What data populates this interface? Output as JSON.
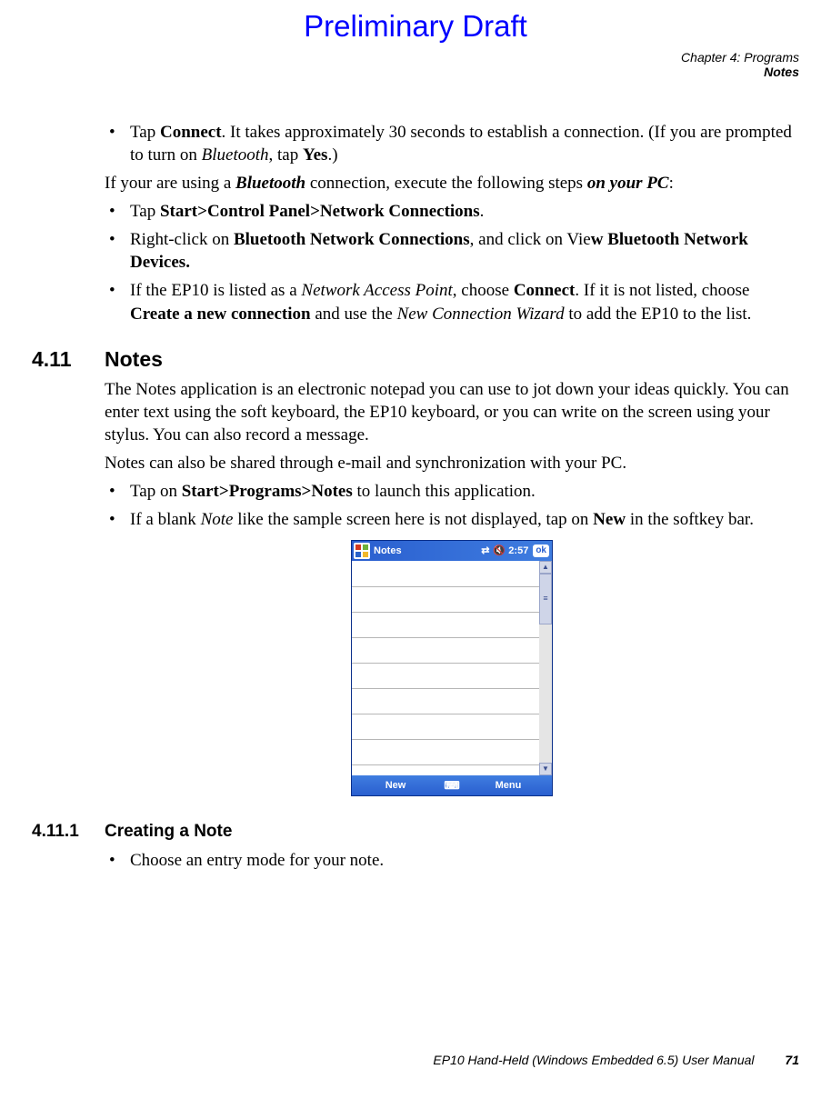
{
  "header": {
    "draft": "Preliminary Draft",
    "chapter": "Chapter 4: Programs",
    "section_label": "Notes"
  },
  "body": {
    "li1_a": "Tap ",
    "li1_b": "Connect",
    "li1_c": ". It takes approximately 30 seconds to establish a connection. (If you are prompted to turn on ",
    "li1_d": "Bluetooth",
    "li1_e": ", tap ",
    "li1_f": "Yes",
    "li1_g": ".)",
    "p1_a": "If your are using a ",
    "p1_b": "Bluetooth",
    "p1_c": " connection, execute the following steps ",
    "p1_d": "on your PC",
    "p1_e": ":",
    "li2_a": "Tap ",
    "li2_b": "Start>Control Panel>Network Connections",
    "li2_c": ".",
    "li3_a": "Right-click on ",
    "li3_b": "Bluetooth Network Connections",
    "li3_c": ", and click on Vie",
    "li3_d": "w Bluetooth Network Devices.",
    "li4_a": "If the EP10 is listed as a ",
    "li4_b": "Network Access Point",
    "li4_c": ", choose ",
    "li4_d": "Connect",
    "li4_e": ". If it is not listed, choose ",
    "li4_f": "Create a new connection",
    "li4_g": " and use the ",
    "li4_h": "New Connection Wizard",
    "li4_i": " to add the EP10 to the list."
  },
  "section_411": {
    "num": "4.11",
    "title": "Notes",
    "p1": "The Notes application is an electronic notepad you can use to jot down your ideas quickly. You can enter text using the soft keyboard, the EP10 keyboard, or you can write on the screen using your stylus. You can also record a message.",
    "p2": "Notes can also be shared through e-mail and synchronization with your PC.",
    "li1_a": "Tap on ",
    "li1_b": "Start>Programs>Notes",
    "li1_c": " to launch this application.",
    "li2_a": "If a blank ",
    "li2_b": "Note",
    "li2_c": " like the sample screen here is not displayed, tap on ",
    "li2_d": "New",
    "li2_e": " in the softkey bar."
  },
  "section_4111": {
    "num": "4.11.1",
    "title": "Creating a Note",
    "li1": "Choose an entry mode for your note."
  },
  "device": {
    "title": "Notes",
    "time": "2:57",
    "ok": "ok",
    "softkey_left": "New",
    "softkey_right": "Menu"
  },
  "footer": {
    "doc": "EP10 Hand-Held (Windows Embedded 6.5) User Manual",
    "page": "71"
  }
}
